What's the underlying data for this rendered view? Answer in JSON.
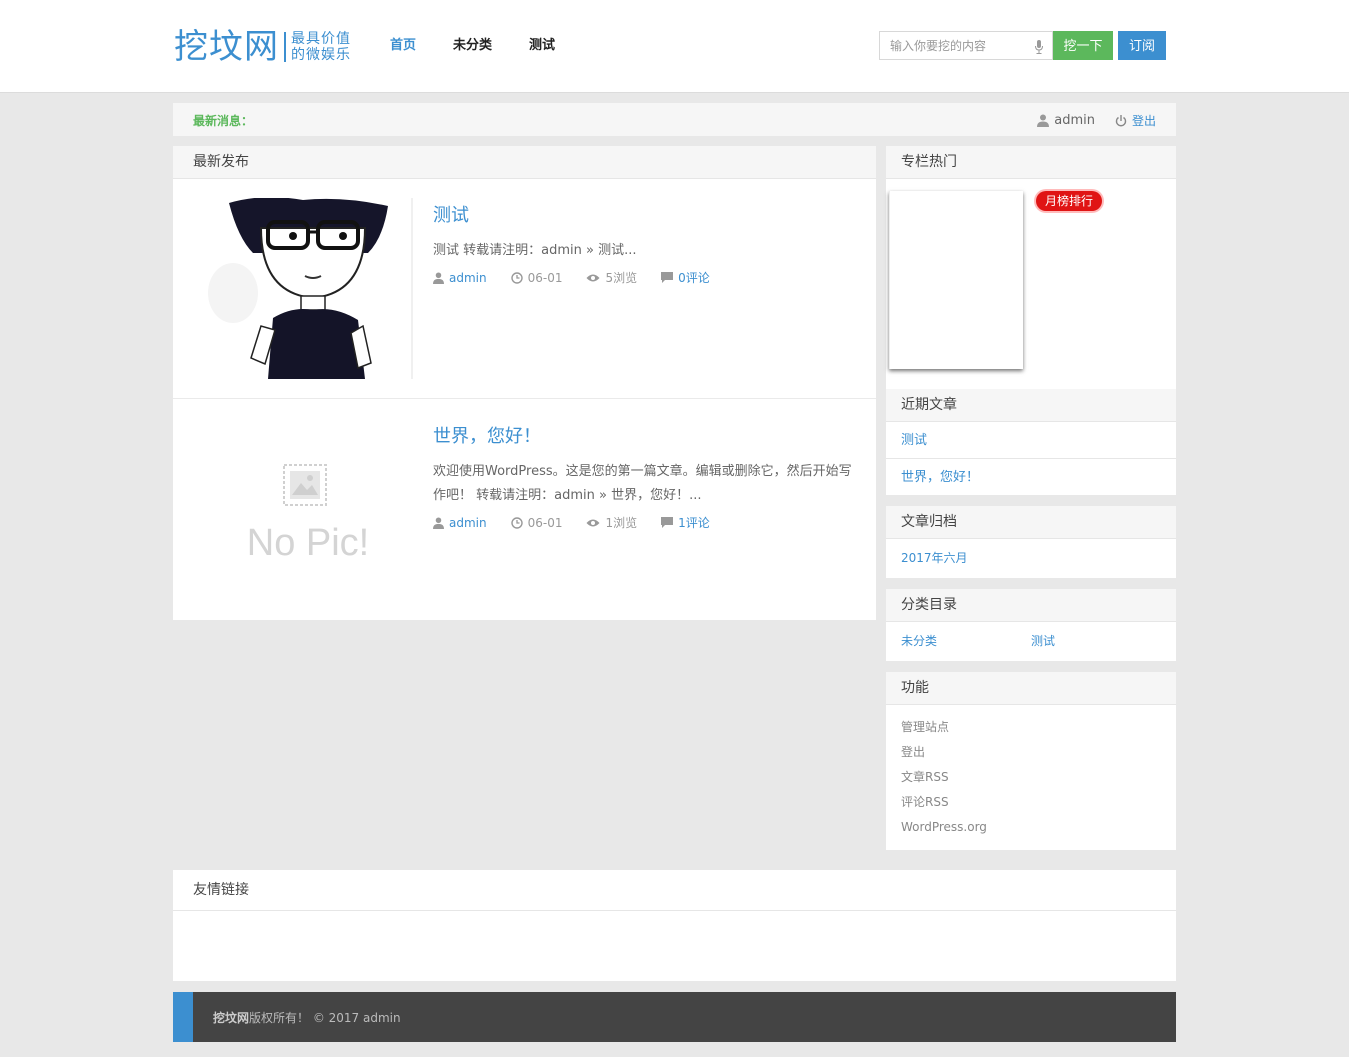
{
  "header": {
    "logo_main": "挖坟网",
    "logo_sub_1": "最具价值",
    "logo_sub_2": "的微娱乐",
    "nav": [
      "首页",
      "未分类",
      "测试"
    ],
    "search_placeholder": "输入你要挖的内容",
    "search_button": "挖一下",
    "subscribe_button": "订阅",
    "accent_color": "#3c8fd0",
    "green_color": "#5cb85c"
  },
  "newsbar": {
    "label": "最新消息：",
    "user": "admin",
    "logout": "登出"
  },
  "main": {
    "heading": "最新发布",
    "posts": [
      {
        "title": "测试",
        "excerpt": "测试 转载请注明：admin » 测试...",
        "author": "admin",
        "date": "06-01",
        "views": "5浏览",
        "comments": "0评论",
        "thumb_icon": "cartoon-boy-glasses-image"
      },
      {
        "title": "世界，您好！",
        "excerpt": "欢迎使用WordPress。这是您的第一篇文章。编辑或删除它，然后开始写作吧！ 转载请注明：admin » 世界，您好！...",
        "author": "admin",
        "date": "06-01",
        "views": "1浏览",
        "comments": "1评论",
        "thumb_text": "No Pic!"
      }
    ]
  },
  "sidebar": {
    "hot": {
      "heading": "专栏热门",
      "badge": "月榜排行"
    },
    "recent": {
      "heading": "近期文章",
      "items": [
        "测试",
        "世界，您好！"
      ]
    },
    "archive": {
      "heading": "文章归档",
      "items": [
        "2017年六月"
      ]
    },
    "categories": {
      "heading": "分类目录",
      "items": [
        "未分类",
        "测试"
      ]
    },
    "functions": {
      "heading": "功能",
      "items": [
        "管理站点",
        "登出",
        "文章RSS",
        "评论RSS",
        "WordPress.org"
      ]
    }
  },
  "links": {
    "heading": "友情链接"
  },
  "footer": {
    "brand": "挖坟网",
    "text": "版权所有！ © 2017 admin"
  }
}
